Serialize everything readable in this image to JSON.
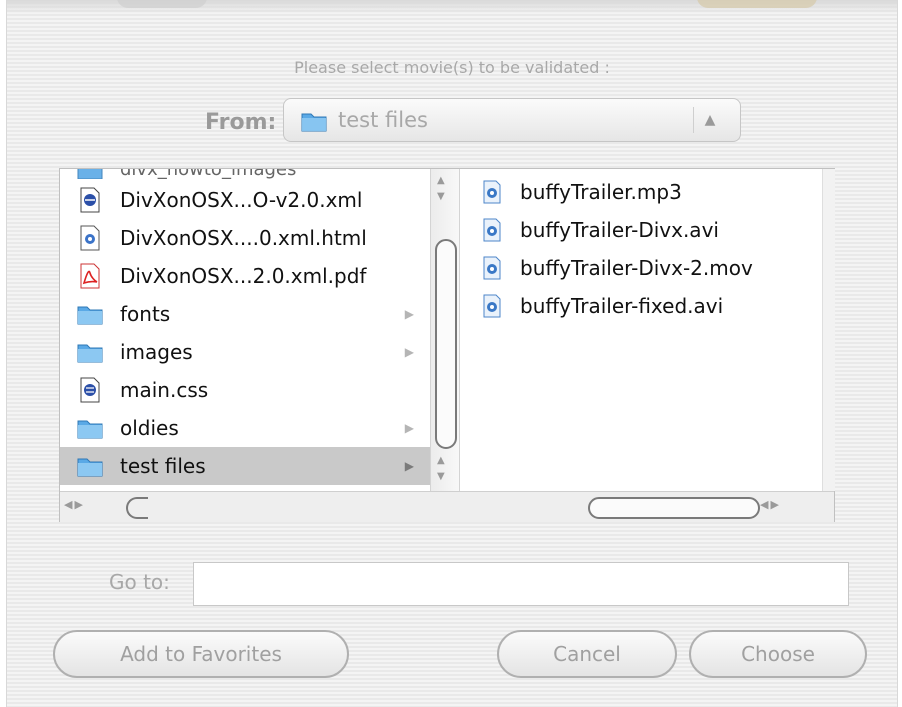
{
  "dialog": {
    "prompt": "Please select movie(s) to be validated :",
    "from_label": "From:",
    "from_value": "test files",
    "goto_label": "Go to:",
    "goto_value": ""
  },
  "browser": {
    "left_column": [
      {
        "name": "DivXonOSX...O-v2.0.xml",
        "icon": "xml-document-icon",
        "has_children": false
      },
      {
        "name": "DivXonOSX....0.xml.html",
        "icon": "html-document-icon",
        "has_children": false
      },
      {
        "name": "DivXonOSX...2.0.xml.pdf",
        "icon": "pdf-document-icon",
        "has_children": false
      },
      {
        "name": "fonts",
        "icon": "folder-icon",
        "has_children": true
      },
      {
        "name": "images",
        "icon": "folder-icon",
        "has_children": true
      },
      {
        "name": "main.css",
        "icon": "css-document-icon",
        "has_children": false
      },
      {
        "name": "oldies",
        "icon": "folder-icon",
        "has_children": true
      },
      {
        "name": "test files",
        "icon": "folder-icon",
        "has_children": true,
        "selected": true
      }
    ],
    "right_column": [
      {
        "name": "buffyTrailer.mp3",
        "icon": "media-file-icon"
      },
      {
        "name": "buffyTrailer-Divx.avi",
        "icon": "media-file-icon"
      },
      {
        "name": "buffyTrailer-Divx-2.mov",
        "icon": "media-file-icon"
      },
      {
        "name": "buffyTrailer-fixed.avi",
        "icon": "media-file-icon"
      }
    ]
  },
  "buttons": {
    "add_favorites": "Add to Favorites",
    "cancel": "Cancel",
    "choose": "Choose"
  },
  "colors": {
    "selection": "#c9c9c9",
    "disabled_text": "#a8a8a8",
    "folder_blue": "#5aa9e6"
  }
}
